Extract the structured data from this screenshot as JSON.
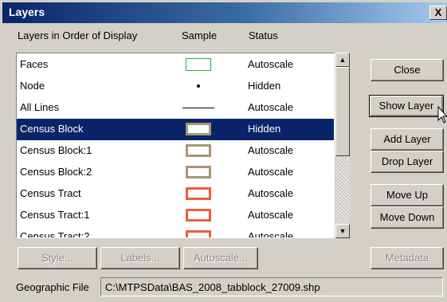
{
  "window": {
    "title": "Layers",
    "close_glyph": "X"
  },
  "headers": {
    "layers": "Layers in Order of Display",
    "sample": "Sample",
    "status": "Status"
  },
  "layers": [
    {
      "name": "Faces",
      "status": "Autoscale",
      "sample": "rect",
      "color": "#22aa44",
      "selected": false
    },
    {
      "name": "Node",
      "status": "Hidden",
      "sample": "dot",
      "color": "#000000",
      "selected": false
    },
    {
      "name": "All Lines",
      "status": "Autoscale",
      "sample": "line",
      "color": "#000000",
      "selected": false
    },
    {
      "name": "Census Block",
      "status": "Hidden",
      "sample": "rect",
      "color": "#a89672",
      "selected": true
    },
    {
      "name": "Census Block:1",
      "status": "Autoscale",
      "sample": "rect",
      "color": "#a89672",
      "selected": false
    },
    {
      "name": "Census Block:2",
      "status": "Autoscale",
      "sample": "rect",
      "color": "#a89672",
      "selected": false
    },
    {
      "name": "Census Tract",
      "status": "Autoscale",
      "sample": "rect",
      "color": "#e8603c",
      "selected": false
    },
    {
      "name": "Census Tract:1",
      "status": "Autoscale",
      "sample": "rect",
      "color": "#e8603c",
      "selected": false
    },
    {
      "name": "Census Tract:2",
      "status": "Autoscale",
      "sample": "rect",
      "color": "#e8603c",
      "selected": false
    }
  ],
  "buttons": {
    "close": "Close",
    "show_layer": "Show Layer",
    "add_layer": "Add Layer",
    "drop_layer": "Drop Layer",
    "move_up": "Move Up",
    "move_down": "Move Down",
    "style": "Style...",
    "labels": "Labels...",
    "autoscale": "Autoscale...",
    "metadata": "Metadata"
  },
  "geo": {
    "label": "Geographic File",
    "path": "C:\\MTPSData\\BAS_2008_tabblock_27009.shp"
  }
}
